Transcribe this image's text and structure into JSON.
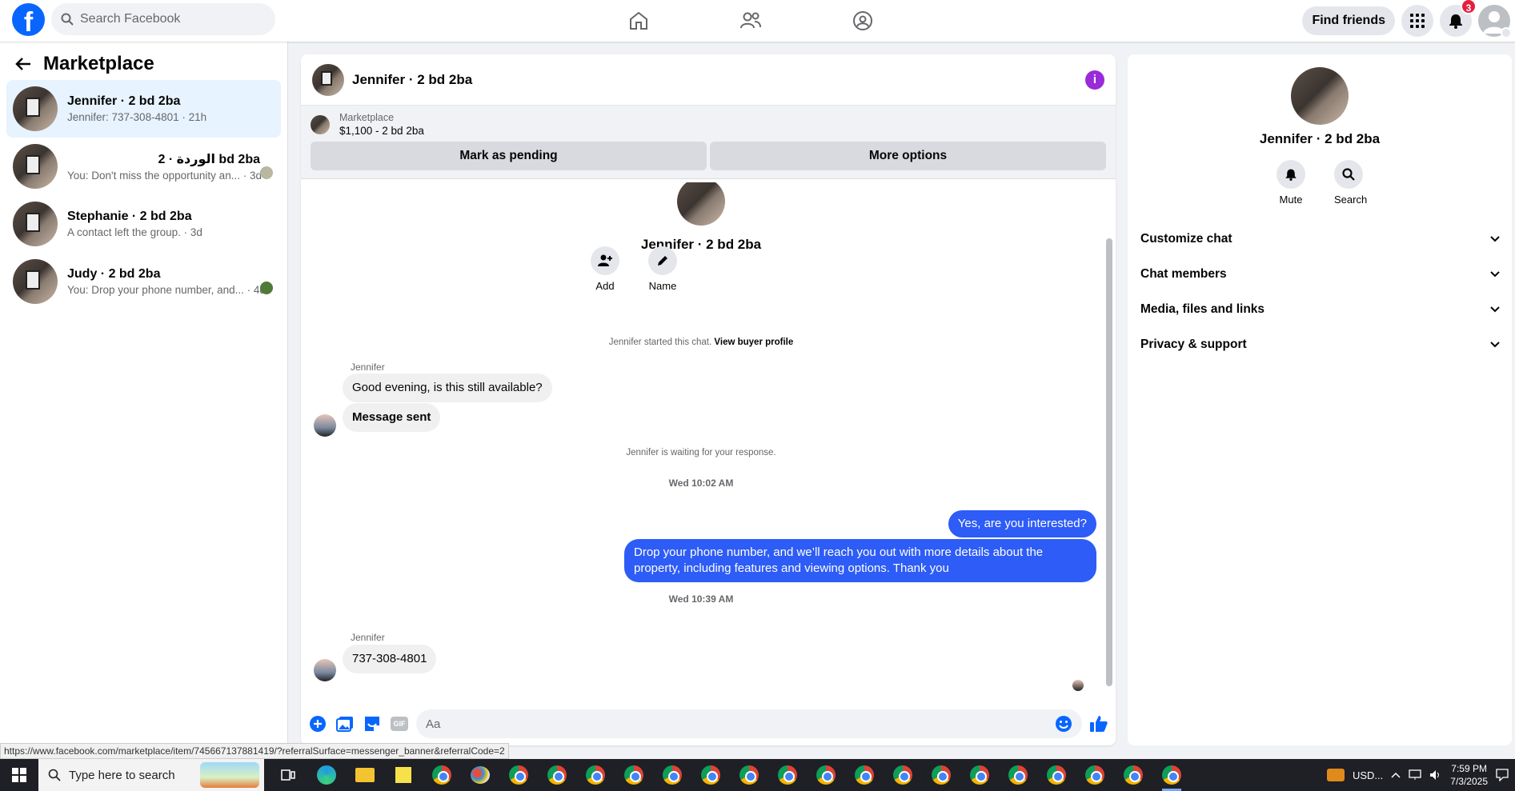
{
  "topbar": {
    "search_placeholder": "Search Facebook",
    "find_friends": "Find friends",
    "notifications_count": "3"
  },
  "sidebar": {
    "title": "Marketplace",
    "conversations": [
      {
        "name": "Jennifer · 2 bd 2ba",
        "preview": "Jennifer: 737-308-4801 · 21h",
        "active": true
      },
      {
        "name": "الوردة · 2 bd 2ba",
        "preview": "You: Don't miss the opportunity an... · 3d"
      },
      {
        "name": "Stephanie · 2 bd 2ba",
        "preview": "A contact left the group. · 3d"
      },
      {
        "name": "Judy · 2 bd 2ba",
        "preview": "You: Drop your phone number, and... · 4d"
      }
    ]
  },
  "chat": {
    "title": "Jennifer · 2 bd 2ba",
    "banner": {
      "label": "Marketplace",
      "price": "$1,100 - 2 bd 2ba",
      "mark_pending": "Mark as pending",
      "more_options": "More options"
    },
    "profile_name": "Jennifer · 2 bd 2ba",
    "add_label": "Add",
    "name_label": "Name",
    "started_text": "Jennifer started this chat.",
    "view_profile": "View buyer profile",
    "sender1": "Jennifer",
    "msg1": "Good evening, is this still available?",
    "msg2": "Message sent",
    "waiting": "Jennifer is waiting for your response.",
    "ts1": "Wed 10:02 AM",
    "out1": "Yes, are you interested?",
    "out2": "Drop your phone number, and we’ll reach you out with more details about the property, including features and viewing options.  Thank you",
    "ts2": "Wed 10:39 AM",
    "sender2": "Jennifer",
    "msg3": "737-308-4801",
    "composer_placeholder": "Aa"
  },
  "details": {
    "name": "Jennifer · 2 bd 2ba",
    "mute": "Mute",
    "search": "Search",
    "sections": [
      "Customize chat",
      "Chat members",
      "Media, files and links",
      "Privacy & support"
    ]
  },
  "status_url": "https://www.facebook.com/marketplace/item/745667137881419/?referralSurface=messenger_banner&referralCode=2",
  "taskbar": {
    "search_placeholder": "Type here to search",
    "currency": "USD...",
    "time": "7:59 PM",
    "date": "7/3/2025"
  }
}
